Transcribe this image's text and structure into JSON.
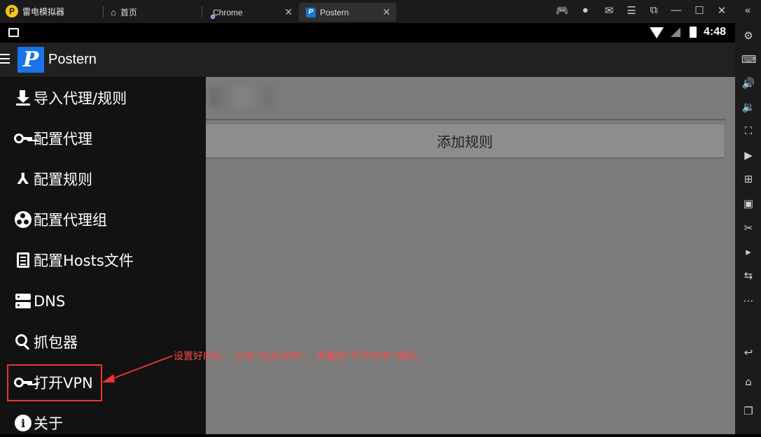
{
  "emulator": {
    "app_name": "雷电模拟器",
    "tabs": [
      {
        "label": "首页",
        "icon": "home-icon"
      },
      {
        "label": "Chrome",
        "icon": "chrome-icon"
      },
      {
        "label": "Postern",
        "icon": "postern-icon",
        "active": true
      }
    ]
  },
  "statusbar": {
    "time": "4:48"
  },
  "app": {
    "logo_letter": "P",
    "title": "Postern"
  },
  "main": {
    "add_rule_label": "添加规则"
  },
  "drawer": {
    "items": [
      {
        "label": "导入代理/规则",
        "icon": "download-icon"
      },
      {
        "label": "配置代理",
        "icon": "key-icon"
      },
      {
        "label": "配置规则",
        "icon": "fork-icon"
      },
      {
        "label": "配置代理组",
        "icon": "group-icon"
      },
      {
        "label": "配置Hosts文件",
        "icon": "file-icon"
      },
      {
        "label": "DNS",
        "icon": "dns-icon"
      },
      {
        "label": "抓包器",
        "icon": "search-icon"
      },
      {
        "label": "打开VPN",
        "icon": "key-icon"
      },
      {
        "label": "关于",
        "icon": "info-icon"
      }
    ]
  },
  "annotation": {
    "text": "设置好IP后， 点击“关闭VPN”， 再重新“打开VPN”按钮。",
    "color": "#ff4a4a"
  },
  "colors": {
    "accent": "#1a73e8",
    "highlight": "#e33333"
  }
}
